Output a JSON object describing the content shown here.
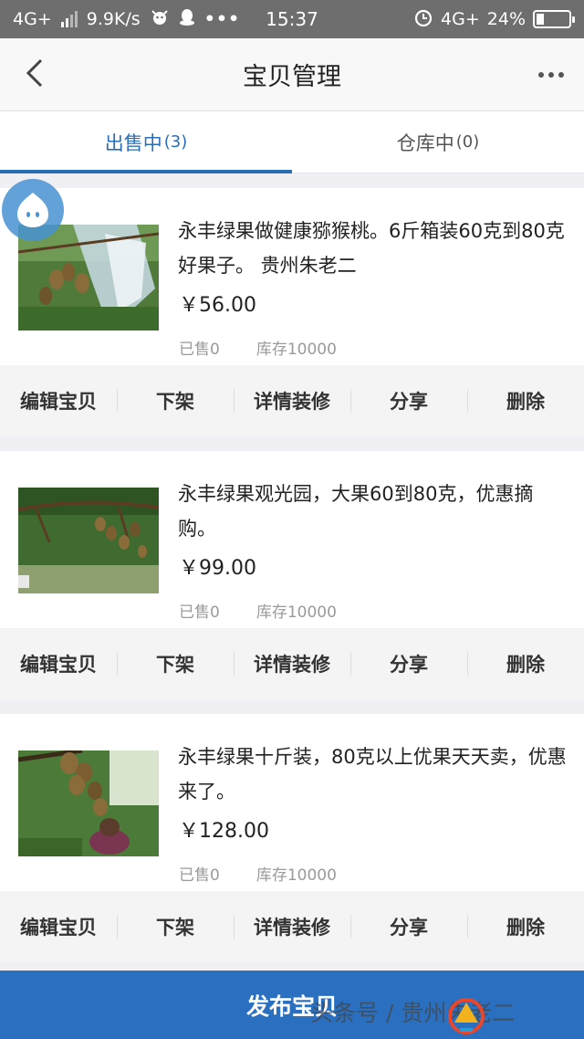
{
  "status_bar": {
    "network_left": "4G+",
    "speed": "9.9K/s",
    "time": "15:37",
    "network_right": "4G+",
    "battery": "24%",
    "icons": [
      "signal-icon",
      "cow-icon",
      "qq-penguin-icon",
      "ellipsis-icon",
      "alarm-icon",
      "battery-icon"
    ]
  },
  "nav": {
    "title": "宝贝管理"
  },
  "tabs": [
    {
      "label": "出售中",
      "count": "(3)",
      "active": true
    },
    {
      "label": "仓库中",
      "count": "(0)",
      "active": false
    }
  ],
  "products": [
    {
      "title": "永丰绿果做健康猕猴桃。6斤箱装60克到80克好果子。 贵州朱老二",
      "price": "￥56.00",
      "sold": "已售0",
      "stock": "库存10000"
    },
    {
      "title": "永丰绿果观光园，大果60到80克，优惠摘购。",
      "price": "￥99.00",
      "sold": "已售0",
      "stock": "库存10000"
    },
    {
      "title": "永丰绿果十斤装，80克以上优果天天卖，优惠来了。",
      "price": "￥128.00",
      "sold": "已售0",
      "stock": "库存10000"
    }
  ],
  "actions": {
    "edit": "编辑宝贝",
    "delist": "下架",
    "decorate": "详情装修",
    "share": "分享",
    "delete": "删除"
  },
  "publish_label": "发布宝贝",
  "watermark": {
    "text": "头条号 / 贵州朱老二"
  },
  "colors": {
    "accent": "#2a6fb6",
    "publish_bar": "#2a6fc0",
    "status_bar": "#6e6e6e"
  }
}
